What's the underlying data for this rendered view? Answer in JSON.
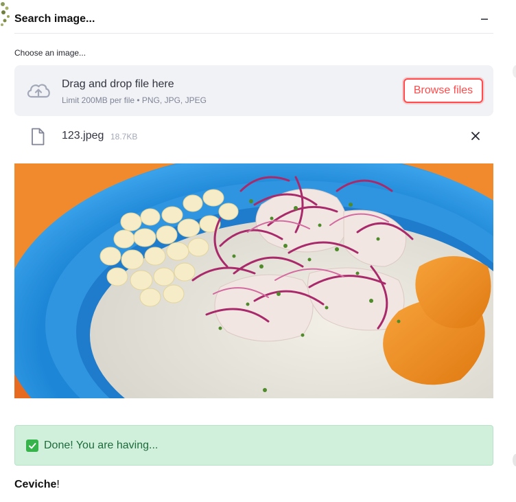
{
  "expander": {
    "title": "Search image...",
    "toggle_symbol": "−",
    "toggle_icon": "minus-icon"
  },
  "uploader": {
    "label": "Choose an image...",
    "drop_text": "Drag and drop file here",
    "limit_text": "Limit 200MB per file • PNG, JPG, JPEG",
    "browse_label": "Browse files",
    "upload_icon": "cloud-upload-icon",
    "accent_color": "#ff4b4b",
    "background_color": "#f0f2f6"
  },
  "file": {
    "name": "123.jpeg",
    "size": "18.7KB",
    "file_icon": "document-icon",
    "remove_icon": "close-icon"
  },
  "image": {
    "subject": "photo-of-ceviche-dish"
  },
  "alert": {
    "emoji": "✅",
    "message": "Done! You are having...",
    "background_color": "#d1f0dc"
  },
  "result": {
    "dish": "Ceviche",
    "suffix": "!"
  }
}
